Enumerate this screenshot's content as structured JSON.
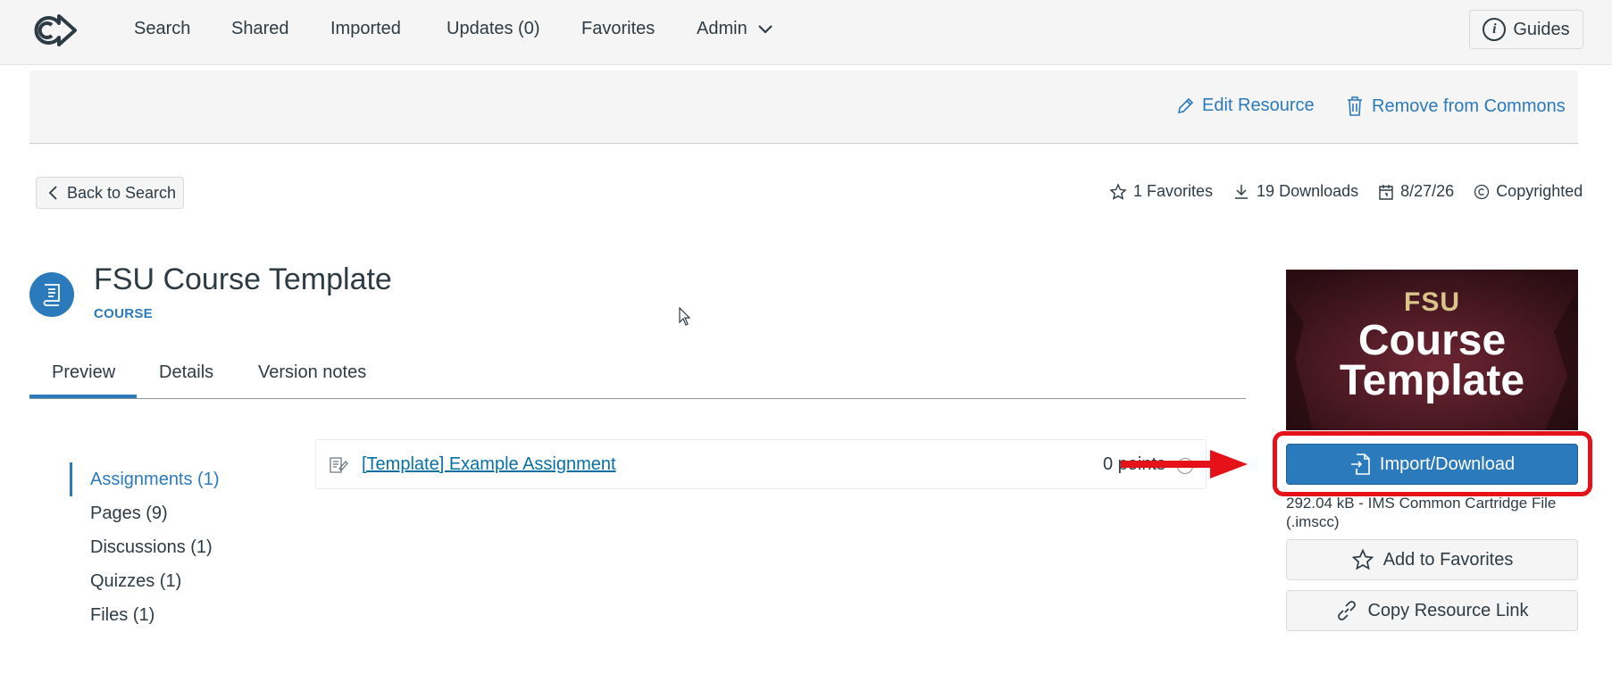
{
  "nav": {
    "logo_icon": "commons-logo-icon",
    "items": [
      {
        "label": "Search"
      },
      {
        "label": "Shared"
      },
      {
        "label": "Imported"
      },
      {
        "label": "Updates (0)"
      },
      {
        "label": "Favorites"
      },
      {
        "label": "Admin"
      }
    ],
    "guides_label": "Guides"
  },
  "admin_bar": {
    "edit_label": "Edit Resource",
    "remove_label": "Remove from Commons"
  },
  "back_label": "Back to Search",
  "stats": {
    "favorites": "1 Favorites",
    "downloads": "19 Downloads",
    "date": "8/27/26",
    "license": "Copyrighted"
  },
  "resource": {
    "title": "FSU Course Template",
    "type": "COURSE"
  },
  "tabs": [
    {
      "label": "Preview",
      "active": true
    },
    {
      "label": "Details"
    },
    {
      "label": "Version notes"
    }
  ],
  "sidebar": {
    "items": [
      {
        "label": "Assignments (1)",
        "active": true
      },
      {
        "label": "Pages (9)"
      },
      {
        "label": "Discussions (1)"
      },
      {
        "label": "Quizzes (1)"
      },
      {
        "label": "Files (1)"
      }
    ]
  },
  "assignment": {
    "title": "[Template] Example Assignment",
    "points": "0 points"
  },
  "thumbnail": {
    "line1": "FSU",
    "line2": "Course",
    "line3": "Template"
  },
  "actions": {
    "import_label": "Import/Download",
    "file_info": "292.04 kB - IMS Common Cartridge File (.imscc)",
    "favorite_label": "Add to Favorites",
    "copy_link_label": "Copy Resource Link"
  },
  "colors": {
    "accent": "#2b7abc",
    "highlight": "#e5121a"
  }
}
